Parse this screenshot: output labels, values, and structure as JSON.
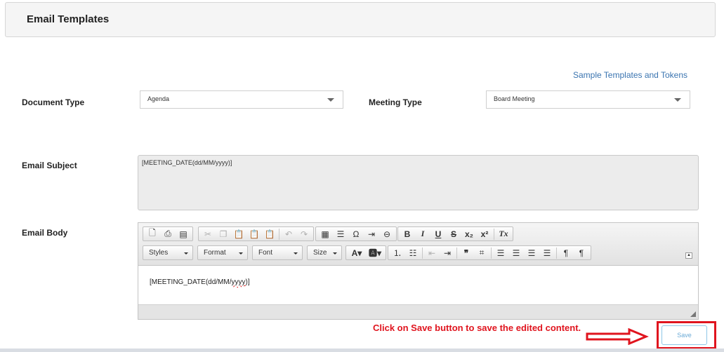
{
  "header": {
    "title": "Email Templates"
  },
  "links": {
    "sample_templates": "Sample Templates and Tokens"
  },
  "form": {
    "document_type_label": "Document Type",
    "document_type_value": "Agenda",
    "meeting_type_label": "Meeting Type",
    "meeting_type_value": "Board Meeting",
    "email_subject_label": "Email Subject",
    "email_subject_value": "[MEETING_DATE(dd/MM/yyyy)]",
    "email_body_label": "Email Body"
  },
  "editor": {
    "styles_label": "Styles",
    "format_label": "Format",
    "font_label": "Font",
    "size_label": "Size",
    "content_prefix": "[MEETING_DATE(dd/MM/",
    "content_spell": "yyyy",
    "content_suffix": ")]"
  },
  "annotation": {
    "text": "Click on Save button to save the edited content."
  },
  "actions": {
    "save_label": "Save"
  },
  "colors": {
    "annotation_red": "#e0141e",
    "link_blue": "#3a74b0",
    "save_blue": "#6aaad6"
  }
}
